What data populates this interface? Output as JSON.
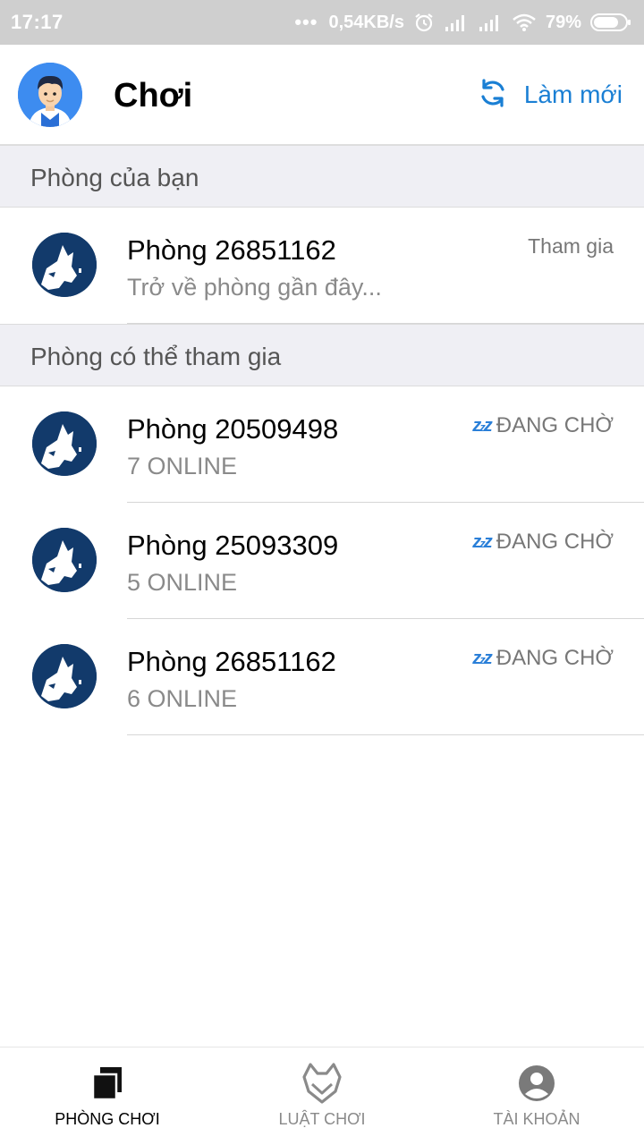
{
  "status_bar": {
    "time": "17:17",
    "dots": "•••",
    "network_speed": "0,54KB/s",
    "battery_percent": "79%",
    "battery_level": 0.79
  },
  "header": {
    "title": "Chơi",
    "refresh_label": "Làm mới",
    "avatar_icon": "user-avatar-icon",
    "refresh_icon": "refresh-icon"
  },
  "sections": {
    "your_room": "Phòng của bạn",
    "joinable_rooms": "Phòng có thể tham gia"
  },
  "your_room": {
    "name": "Phòng 26851162",
    "subtitle": "Trở về phòng gần đây...",
    "action": "Tham gia"
  },
  "rooms": [
    {
      "name": "Phòng 20509498",
      "online": "7 ONLINE",
      "status": "ĐANG CHỜ"
    },
    {
      "name": "Phòng 25093309",
      "online": "5 ONLINE",
      "status": "ĐANG CHỜ"
    },
    {
      "name": "Phòng 26851162",
      "online": "6 ONLINE",
      "status": "ĐANG CHỜ"
    }
  ],
  "bottom_nav": [
    {
      "label": "PHÒNG CHƠI",
      "icon": "rooms-icon",
      "active": true
    },
    {
      "label": "LUẬT CHƠI",
      "icon": "wolf-icon",
      "active": false
    },
    {
      "label": "TÀI KHOẢN",
      "icon": "account-icon",
      "active": false
    }
  ],
  "colors": {
    "accent": "#1a7fd4",
    "room_icon_bg": "#123a6b",
    "avatar_bg": "#3d8cf0",
    "section_bg": "#efeff4",
    "status_bar_bg": "#cfcfcf"
  }
}
